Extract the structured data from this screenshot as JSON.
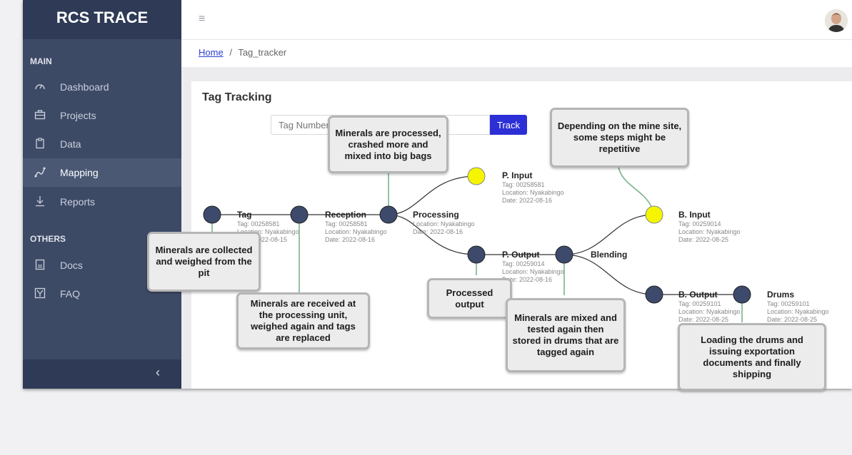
{
  "app": {
    "title": "RCS TRACE"
  },
  "sidebar": {
    "section_main": "MAIN",
    "section_others": "OTHERS",
    "items": [
      {
        "label": "Dashboard",
        "icon": "gauge-icon"
      },
      {
        "label": "Projects",
        "icon": "briefcase-icon"
      },
      {
        "label": "Data",
        "icon": "clipboard-icon"
      },
      {
        "label": "Mapping",
        "icon": "route-icon"
      },
      {
        "label": "Reports",
        "icon": "download-icon"
      }
    ],
    "others": [
      {
        "label": "Docs",
        "icon": "document-icon"
      },
      {
        "label": "FAQ",
        "icon": "faq-icon"
      }
    ],
    "collapse_glyph": "‹",
    "active": "Mapping"
  },
  "topbar": {
    "menu_glyph": "≡"
  },
  "breadcrumb": {
    "home": "Home",
    "separator": "/",
    "current": "Tag_tracker"
  },
  "page": {
    "title": "Tag Tracking",
    "search": {
      "placeholder": "Tag Number",
      "value": ""
    },
    "track_button": "Track"
  },
  "graph": {
    "nodes": [
      {
        "name": "Tag",
        "tag": "Tag: 00258581",
        "location": "Location: Nyakabingo",
        "date": "Date: 2022-08-15",
        "color": "#3d4a6b"
      },
      {
        "name": "Reception",
        "tag": "Tag: 00258581",
        "location": "Location: Nyakabingo",
        "date": "Date: 2022-08-16",
        "color": "#3d4a6b"
      },
      {
        "name": "Processing",
        "tag": "",
        "location": "Location: Nyakabingo",
        "date": "Date: 2022-08-16",
        "color": "#3d4a6b"
      },
      {
        "name": "P. Input",
        "tag": "Tag: 00258581",
        "location": "Location: Nyakabingo",
        "date": "Date: 2022-08-16",
        "color": "#f5f500"
      },
      {
        "name": "P. Output",
        "tag": "Tag: 00259014",
        "location": "Location: Nyakabingo",
        "date": "Date: 2022-08-16",
        "color": "#3d4a6b"
      },
      {
        "name": "Blending",
        "tag": "",
        "location": "",
        "date": "",
        "color": "#3d4a6b"
      },
      {
        "name": "B. Input",
        "tag": "Tag: 00259014",
        "location": "Location: Nyakabingo",
        "date": "Date: 2022-08-25",
        "color": "#f5f500"
      },
      {
        "name": "B. Output",
        "tag": "Tag: 00259101",
        "location": "Location: Nyakabingo",
        "date": "Date: 2022-08-25",
        "color": "#3d4a6b"
      },
      {
        "name": "Drums",
        "tag": "Tag: 00259101",
        "location": "Location: Nyakabingo",
        "date": "Date: 2022-08-25",
        "color": "#3d4a6b"
      }
    ]
  },
  "callouts": [
    "Minerals are collected and weighed from the pit",
    "Minerals are received at the processing unit, weighed again and tags are replaced",
    "Minerals are processed, crashed more and mixed into big bags",
    "Processed output",
    "Minerals are mixed and tested again then stored in drums that are tagged again",
    "Depending on the mine site, some steps might be repetitive",
    "Loading the drums and issuing exportation documents and finally shipping"
  ],
  "colors": {
    "sidebar": "#3d4a66",
    "brand_bg": "#2e3a56",
    "accent": "#2d2fd6",
    "link": "#2c3fd1",
    "node_dark": "#3d4a6b",
    "node_yellow": "#f5f500",
    "connector": "#7ab38e"
  }
}
